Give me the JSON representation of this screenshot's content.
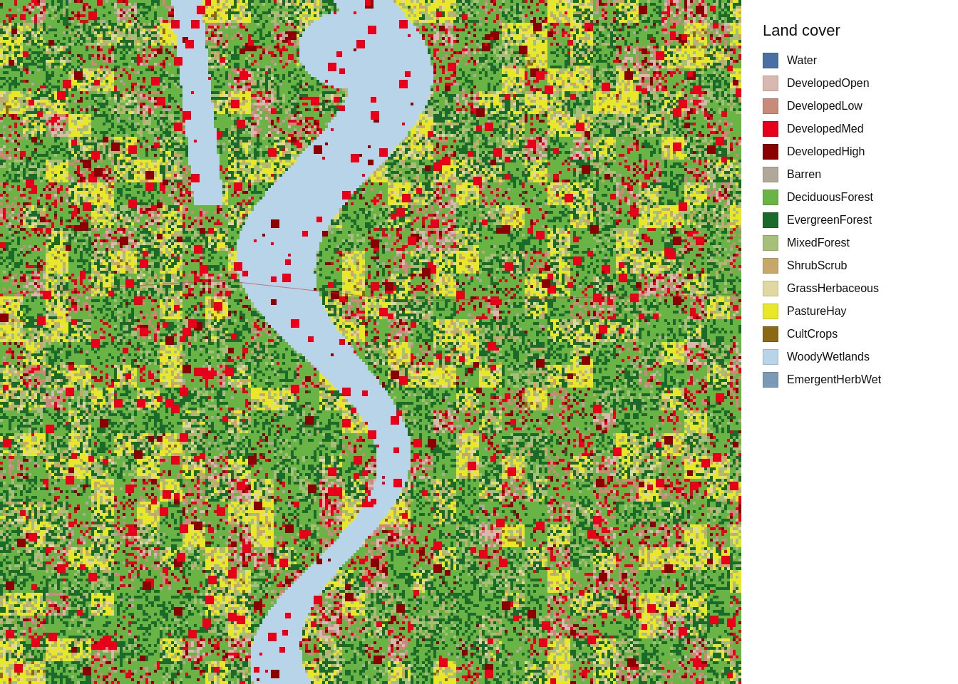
{
  "legend": {
    "title": "Land cover",
    "items": [
      {
        "id": "water",
        "label": "Water",
        "color": "#4a6fa5"
      },
      {
        "id": "developed-open",
        "label": "DevelopedOpen",
        "color": "#d9b8b0"
      },
      {
        "id": "developed-low",
        "label": "DevelopedLow",
        "color": "#c98a7a"
      },
      {
        "id": "developed-med",
        "label": "DevelopedMed",
        "color": "#e8001a"
      },
      {
        "id": "developed-high",
        "label": "DevelopedHigh",
        "color": "#8b0000"
      },
      {
        "id": "barren",
        "label": "Barren",
        "color": "#b0a898"
      },
      {
        "id": "deciduous-forest",
        "label": "DeciduousForest",
        "color": "#6ab446"
      },
      {
        "id": "evergreen-forest",
        "label": "EvergreenForest",
        "color": "#1a6b2a"
      },
      {
        "id": "mixed-forest",
        "label": "MixedForest",
        "color": "#a8bf7a"
      },
      {
        "id": "shrub-scrub",
        "label": "ShrubScrub",
        "color": "#c8a86a"
      },
      {
        "id": "grass-herbaceous",
        "label": "GrassHerbaceous",
        "color": "#e0d8a0"
      },
      {
        "id": "pasture-hay",
        "label": "PastureHay",
        "color": "#e8e828"
      },
      {
        "id": "cult-crops",
        "label": "CultCrops",
        "color": "#8b6914"
      },
      {
        "id": "woody-wetlands",
        "label": "WoodyWetlands",
        "color": "#b8d4e8"
      },
      {
        "id": "emergent-herb-wet",
        "label": "EmergentHerbWet",
        "color": "#7a9ab8"
      }
    ]
  }
}
